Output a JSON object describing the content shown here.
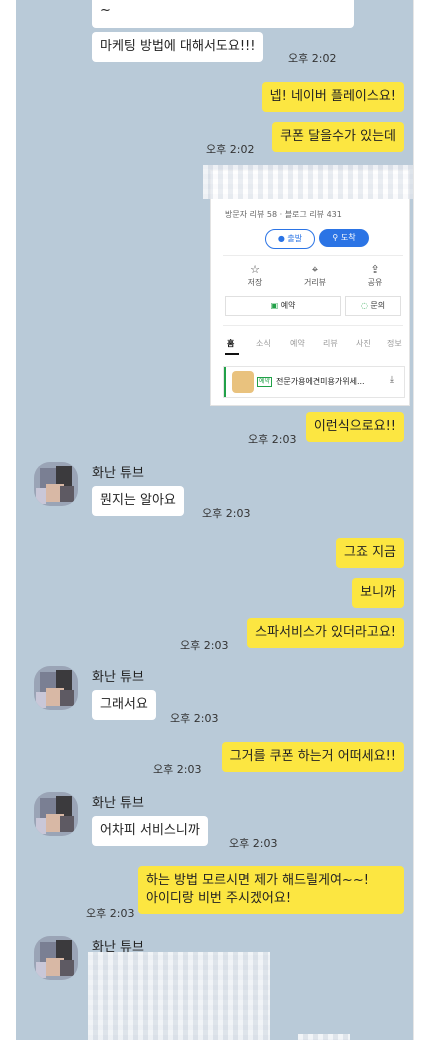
{
  "messages": {
    "m0": "~",
    "m1": "마케팅 방법에 대해서도요!!!",
    "m2": "넵! 네이버 플레이스요!",
    "m3": "쿠폰 달을수가 있는데",
    "m4": "이런식으로요!!",
    "m5": "뭔지는 알아요",
    "m6": "그죠 지금",
    "m7": "보니까",
    "m8": "스파서비스가 있더라고요!",
    "m9": "그래서요",
    "m10": "그거를 쿠폰 하는거 어떠세요!!",
    "m11": "어차피 서비스니까",
    "m12_l1": "하는 방법 모르시면 제가 해드릴게여~~!",
    "m12_l2": "아이디랑 비번 주시겠어요!"
  },
  "times": {
    "t1": "오후 2:02",
    "t2": "오후 2:02",
    "t3": "오후 2:03",
    "t4": "오후 2:03",
    "t5": "오후 2:03",
    "t6": "오후 2:03",
    "t7": "오후 2:03",
    "t8": "오후 2:03",
    "t9": "오후 2:03"
  },
  "sender": {
    "name": "화난 튜브"
  },
  "place_card": {
    "reviews": "방문자 리뷰 58 · 블로그 리뷰 431",
    "depart": "출발",
    "arrive": "도착",
    "actions": [
      "저장",
      "거리뷰",
      "공유"
    ],
    "reserve": "예약",
    "inquiry": "문의",
    "tabs": [
      "홈",
      "소식",
      "예약",
      "리뷰",
      "사진",
      "정보"
    ],
    "coupon_tag": "예약",
    "coupon_title": "전문가용에견미용가위세...",
    "download": "⤓"
  },
  "colors": {
    "chat_background": "#b9cad8",
    "outgoing_bubble": "#fce641",
    "incoming_bubble": "#ffffff",
    "naver_blue": "#2b74e5",
    "naver_green": "#21a148"
  }
}
